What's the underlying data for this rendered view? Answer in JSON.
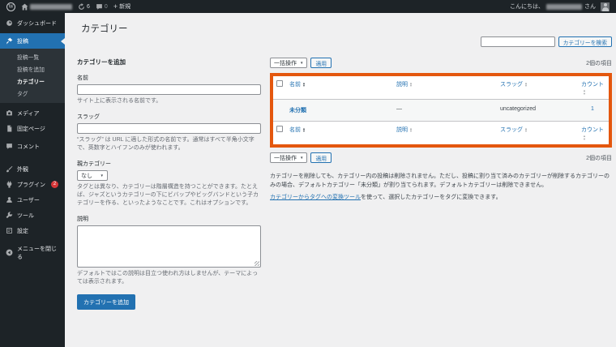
{
  "admin_bar": {
    "updates_count": "6",
    "comments_count": "0",
    "new_label": "新規",
    "greeting_prefix": "こんにちは、",
    "greeting_suffix": "さん"
  },
  "sidebar": {
    "items": [
      {
        "label": "ダッシュボード"
      },
      {
        "label": "投稿"
      },
      {
        "label": "メディア"
      },
      {
        "label": "固定ページ"
      },
      {
        "label": "コメント"
      },
      {
        "label": "外観"
      },
      {
        "label": "プラグイン"
      },
      {
        "label": "ユーザー"
      },
      {
        "label": "ツール"
      },
      {
        "label": "設定"
      }
    ],
    "plugins_badge": "2",
    "submenu": [
      {
        "label": "投稿一覧"
      },
      {
        "label": "投稿を追加"
      },
      {
        "label": "カテゴリー"
      },
      {
        "label": "タグ"
      }
    ],
    "collapse_label": "メニューを閉じる"
  },
  "page": {
    "title": "カテゴリー",
    "search_button": "カテゴリーを検索",
    "items_count": "2個の項目"
  },
  "add_form": {
    "heading": "カテゴリーを追加",
    "name_label": "名前",
    "name_help": "サイト上に表示される名前です。",
    "slug_label": "スラッグ",
    "slug_help": "“スラッグ” は URL に適した形式の名前です。通常はすべて半角小文字で、英数字とハイフンのみが使われます。",
    "parent_label": "親カテゴリー",
    "parent_value": "なし",
    "parent_help": "タグとは異なり、カテゴリーは階層構造を持つことができます。たとえば、ジャズというカテゴリーの下にビバップやビッグバンドという子カテゴリーを作る、といったようなことです。これはオプションです。",
    "description_label": "説明",
    "description_help": "デフォルトではこの説明は目立つ使われ方はしませんが、テーマによっては表示されます。",
    "submit_label": "カテゴリーを追加"
  },
  "table": {
    "bulk_label": "一括操作",
    "apply_label": "適用",
    "headers": {
      "name": "名前",
      "description": "説明",
      "slug": "スラッグ",
      "count": "カウント"
    },
    "rows": [
      {
        "name": "未分類",
        "description": "—",
        "slug": "uncategorized",
        "count": "1"
      }
    ]
  },
  "notes": {
    "delete_note": "カテゴリーを削除しても、カテゴリー内の投稿は削除されません。ただし、投稿に割り当て済みのカテゴリーが削除するカテゴリーのみの場合、デフォルトカテゴリー「未分類」が割り当てられます。デフォルトカテゴリーは削除できません。",
    "converter_link": "カテゴリーからタグへの変換ツール",
    "converter_rest": "を使って、選択したカテゴリーをタグに変換できます。"
  },
  "colors": {
    "accent": "#2271b1",
    "highlight_border": "#e4570e",
    "badge": "#d63638",
    "sidebar_bg": "#1d2327",
    "content_bg": "#f0f0f1"
  }
}
